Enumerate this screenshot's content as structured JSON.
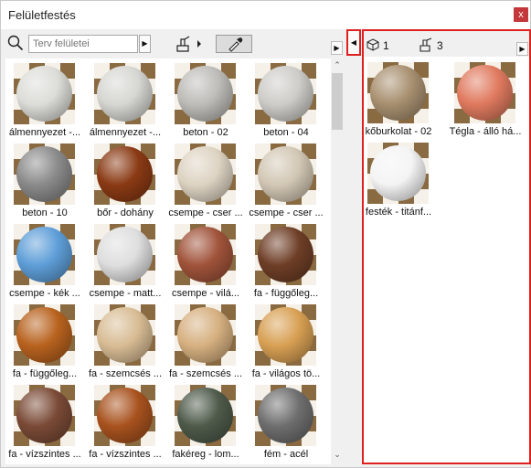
{
  "window": {
    "title": "Felületfestés",
    "close_label": "x"
  },
  "toolbar": {
    "search_placeholder": "Terv felületei",
    "search_icon": "search-icon",
    "arrow_right": "▶",
    "arrow_left": "◀"
  },
  "library": {
    "items": [
      {
        "label": "álmennyezet -...",
        "sphere": "#dcdcd8"
      },
      {
        "label": "álmennyezet -...",
        "sphere": "#d6d6d2"
      },
      {
        "label": "beton - 02",
        "sphere": "#bdbcb8"
      },
      {
        "label": "beton - 04",
        "sphere": "#cdccc8"
      },
      {
        "label": "beton - 10",
        "sphere": "#8a8a8a"
      },
      {
        "label": "bőr - dohány",
        "sphere": "#8a3a14"
      },
      {
        "label": "csempe - cser ...",
        "sphere": "#ddd3c2"
      },
      {
        "label": "csempe - cser ...",
        "sphere": "#d2c7b4"
      },
      {
        "label": "csempe - kék ...",
        "sphere": "#5e9ed8"
      },
      {
        "label": "csempe - matt...",
        "sphere": "#dedede"
      },
      {
        "label": "csempe - vilá...",
        "sphere": "#a0533a"
      },
      {
        "label": "fa - függőleg...",
        "sphere": "#6e3e26"
      },
      {
        "label": "fa - függőleg...",
        "sphere": "#b8621e"
      },
      {
        "label": "fa - szemcsés ...",
        "sphere": "#d8bc94"
      },
      {
        "label": "fa - szemcsés ...",
        "sphere": "#d6b080"
      },
      {
        "label": "fa - világos tö...",
        "sphere": "#d8a054"
      },
      {
        "label": "fa - vízszintes ...",
        "sphere": "#7a4a36"
      },
      {
        "label": "fa - vízszintes ...",
        "sphere": "#a8521e"
      },
      {
        "label": "fakéreg - lom...",
        "sphere": "#4e5a4a"
      },
      {
        "label": "fém - acél",
        "sphere": "#6e6e6e"
      }
    ]
  },
  "selection": {
    "object_count": "1",
    "paint_count": "3",
    "items": [
      {
        "label": "kőburkolat - 02",
        "sphere": "#a89070"
      },
      {
        "label": "Tégla - álló há...",
        "sphere": "#e07a5f"
      },
      {
        "label": "festék - titánf...",
        "sphere": "#f4f4f4"
      }
    ]
  }
}
